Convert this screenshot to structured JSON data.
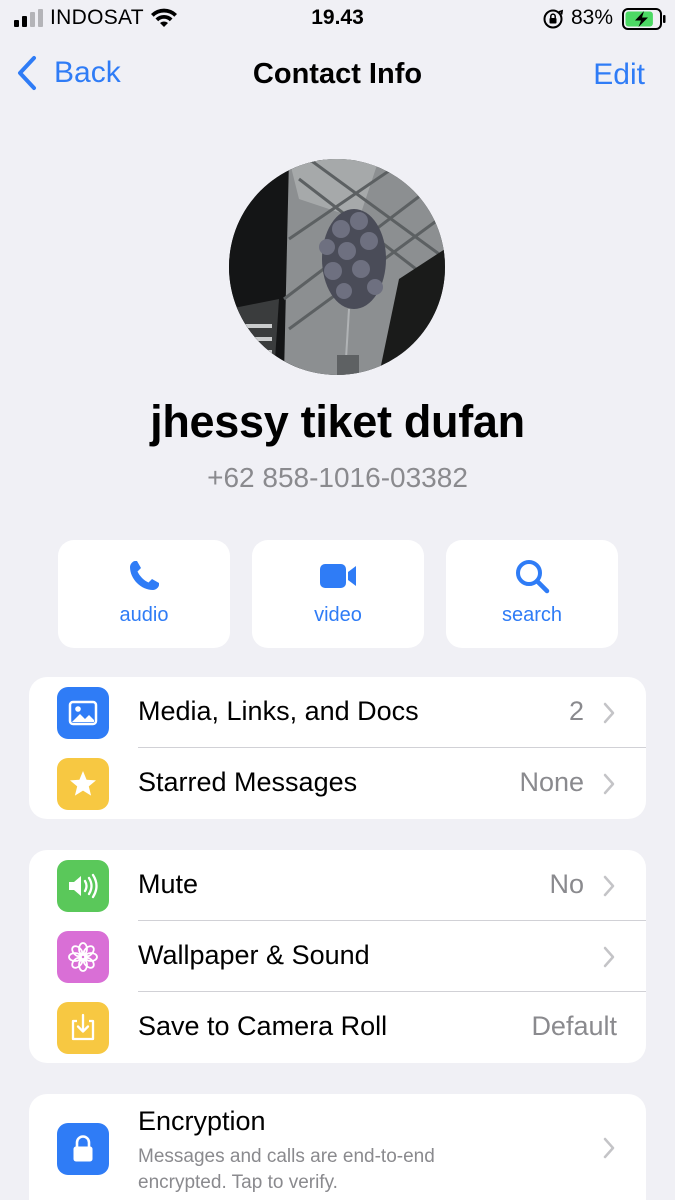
{
  "status_bar": {
    "carrier": "INDOSAT",
    "time": "19.43",
    "battery_percent": "83%",
    "battery_level": 0.83,
    "icons": [
      "signal-icon",
      "wifi-icon",
      "orientation-lock-icon",
      "battery-charging-icon"
    ]
  },
  "nav": {
    "back_label": "Back",
    "title": "Contact Info",
    "edit_label": "Edit"
  },
  "contact": {
    "name": "jhessy tiket dufan",
    "phone": "+62 858-1016-03382"
  },
  "actions": [
    {
      "label": "audio",
      "icon": "phone-icon"
    },
    {
      "label": "video",
      "icon": "video-camera-icon"
    },
    {
      "label": "search",
      "icon": "search-icon"
    }
  ],
  "group1": [
    {
      "label": "Media, Links, and Docs",
      "value": "2",
      "icon": "photo-icon",
      "color": "#2f7cf6"
    },
    {
      "label": "Starred Messages",
      "value": "None",
      "icon": "star-icon",
      "color": "#f7c842"
    }
  ],
  "group2": [
    {
      "label": "Mute",
      "value": "No",
      "icon": "speaker-icon",
      "color": "#5ac85a"
    },
    {
      "label": "Wallpaper & Sound",
      "value": "",
      "icon": "flower-icon",
      "color": "#d96fd6"
    },
    {
      "label": "Save to Camera Roll",
      "value": "Default",
      "icon": "download-icon",
      "color": "#f7c842"
    }
  ],
  "encryption": {
    "title": "Encryption",
    "description": "Messages and calls are end-to-end encrypted. Tap to verify.",
    "icon": "lock-icon",
    "color": "#2f7cf6"
  },
  "colors": {
    "accent": "#2f7cf6",
    "background": "#f0f0f5",
    "secondary_text": "#8a8a8e"
  }
}
